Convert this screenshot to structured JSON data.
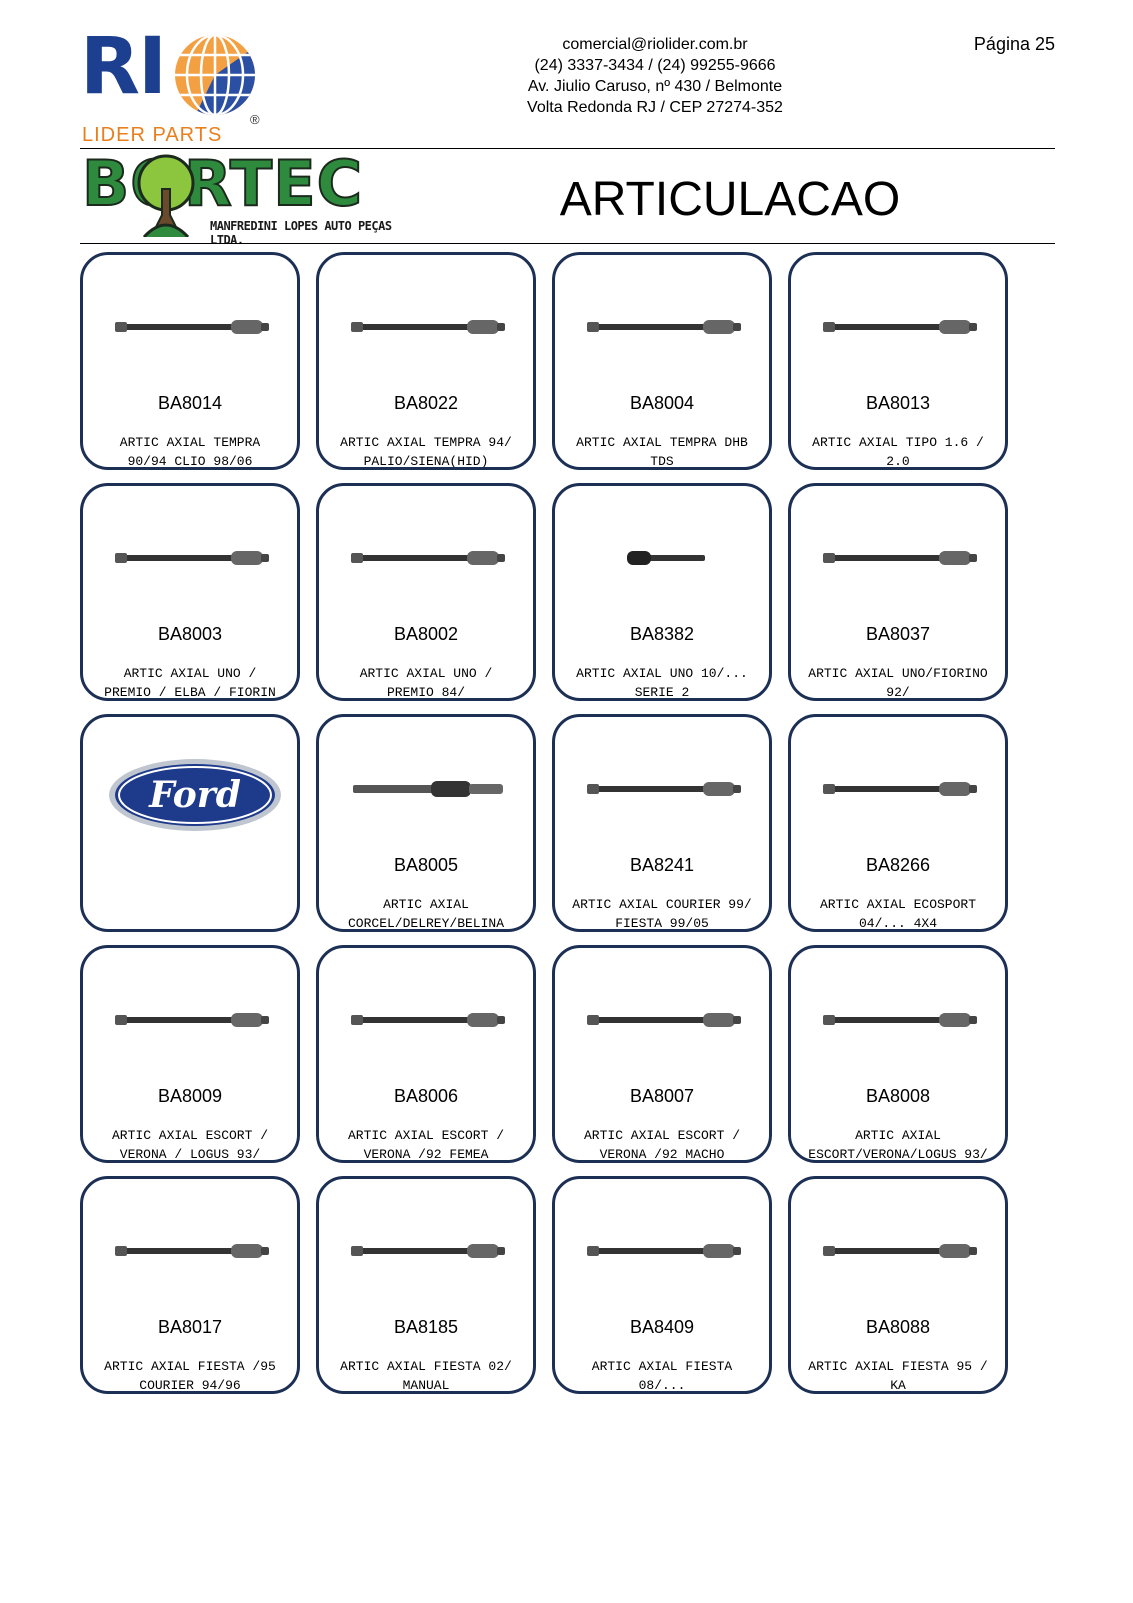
{
  "header": {
    "logo_rio": {
      "letters": "RI",
      "subtitle": "LIDER PARTS",
      "registered": "®"
    },
    "contact": {
      "email": "comercial@riolider.com.br",
      "phones": "(24) 3337-3434 / (24) 99255-9666",
      "address": "Av. Jiulio Caruso, nº 430 / Belmonte",
      "city": "Volta Redonda RJ / CEP 27274-352"
    },
    "page_label": "Página 25",
    "logo_bortec": {
      "name": "BORTEC",
      "subtitle": "MANFREDINI LOPES AUTO PEÇAS LTDA."
    },
    "section_title": "ARTICULACAO"
  },
  "colors": {
    "card_border": "#1c2f54",
    "rio_blue": "#1d3f8f",
    "rio_orange": "#e87f1d",
    "bortec_green": "#2e8b3e",
    "ford_blue": "#1e3a8a"
  },
  "brand_card": {
    "icon": "ford-logo-icon",
    "text": "Ford"
  },
  "products": [
    {
      "code": "BA8014",
      "desc1": "ARTIC AXIAL TEMPRA",
      "desc2": "90/94 CLIO 98/06"
    },
    {
      "code": "BA8022",
      "desc1": "ARTIC AXIAL TEMPRA 94/",
      "desc2": "PALIO/SIENA(HID)"
    },
    {
      "code": "BA8004",
      "desc1": "ARTIC AXIAL TEMPRA DHB",
      "desc2": "TDS"
    },
    {
      "code": "BA8013",
      "desc1": "ARTIC AXIAL TIPO 1.6 /",
      "desc2": "2.0"
    },
    {
      "code": "BA8003",
      "desc1": "ARTIC AXIAL UNO /",
      "desc2": "PREMIO / ELBA / FIORIN"
    },
    {
      "code": "BA8002",
      "desc1": "ARTIC AXIAL UNO /",
      "desc2": "PREMIO 84/"
    },
    {
      "code": "BA8382",
      "desc1": "ARTIC AXIAL UNO 10/...",
      "desc2": "SERIE 2"
    },
    {
      "code": "BA8037",
      "desc1": "ARTIC AXIAL UNO/FIORINO",
      "desc2": "92/"
    },
    {
      "code": "BA8005",
      "desc1": "ARTIC AXIAL",
      "desc2": "CORCEL/DELREY/BELINA"
    },
    {
      "code": "BA8241",
      "desc1": "ARTIC AXIAL COURIER 99/",
      "desc2": "FIESTA 99/05"
    },
    {
      "code": "BA8266",
      "desc1": "ARTIC AXIAL ECOSPORT",
      "desc2": "04/... 4X4"
    },
    {
      "code": "BA8009",
      "desc1": "ARTIC AXIAL ESCORT /",
      "desc2": "VERONA / LOGUS 93/"
    },
    {
      "code": "BA8006",
      "desc1": "ARTIC AXIAL ESCORT /",
      "desc2": "VERONA /92 FEMEA"
    },
    {
      "code": "BA8007",
      "desc1": "ARTIC AXIAL ESCORT /",
      "desc2": "VERONA /92 MACHO"
    },
    {
      "code": "BA8008",
      "desc1": "ARTIC AXIAL",
      "desc2": "ESCORT/VERONA/LOGUS 93/"
    },
    {
      "code": "BA8017",
      "desc1": "ARTIC AXIAL FIESTA /95",
      "desc2": "COURIER 94/96"
    },
    {
      "code": "BA8185",
      "desc1": "ARTIC AXIAL FIESTA 02/",
      "desc2": "MANUAL"
    },
    {
      "code": "BA8409",
      "desc1": "ARTIC AXIAL FIESTA",
      "desc2": "08/..."
    },
    {
      "code": "BA8088",
      "desc1": "ARTIC AXIAL FIESTA 95 /",
      "desc2": "KA"
    }
  ]
}
